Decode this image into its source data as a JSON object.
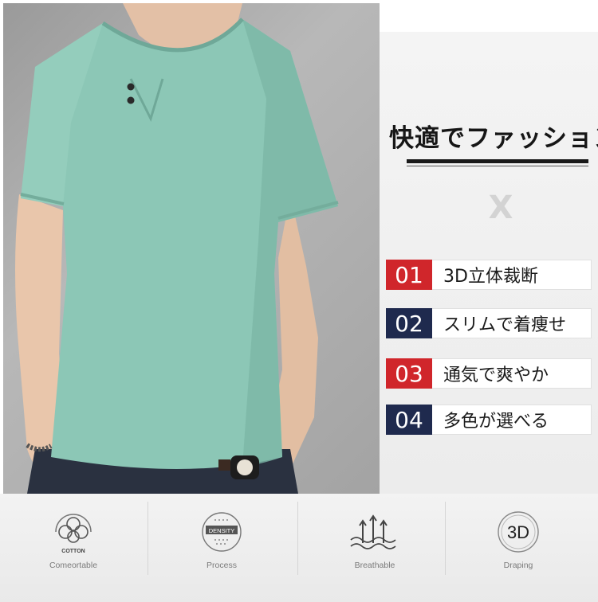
{
  "headline": "快適でファッション",
  "x_mark": "X",
  "features": [
    {
      "num": "01",
      "text": "3D立体裁断",
      "color": "#d0262b"
    },
    {
      "num": "02",
      "text": "スリムで着痩せ",
      "color": "#1f2a4e"
    },
    {
      "num": "03",
      "text": "通気で爽やか",
      "color": "#d0262b"
    },
    {
      "num": "04",
      "text": "多色が選べる",
      "color": "#1f2a4e"
    }
  ],
  "icons": [
    {
      "name": "cotton",
      "icon_text": "COTTON",
      "label": "Comeortable"
    },
    {
      "name": "density",
      "icon_text": "DENSITY",
      "label": "Process"
    },
    {
      "name": "breathable",
      "label": "Breathable"
    },
    {
      "name": "3d",
      "icon_text": "3D",
      "label": "Draping"
    }
  ],
  "shirt_color": "#8cc7b6"
}
